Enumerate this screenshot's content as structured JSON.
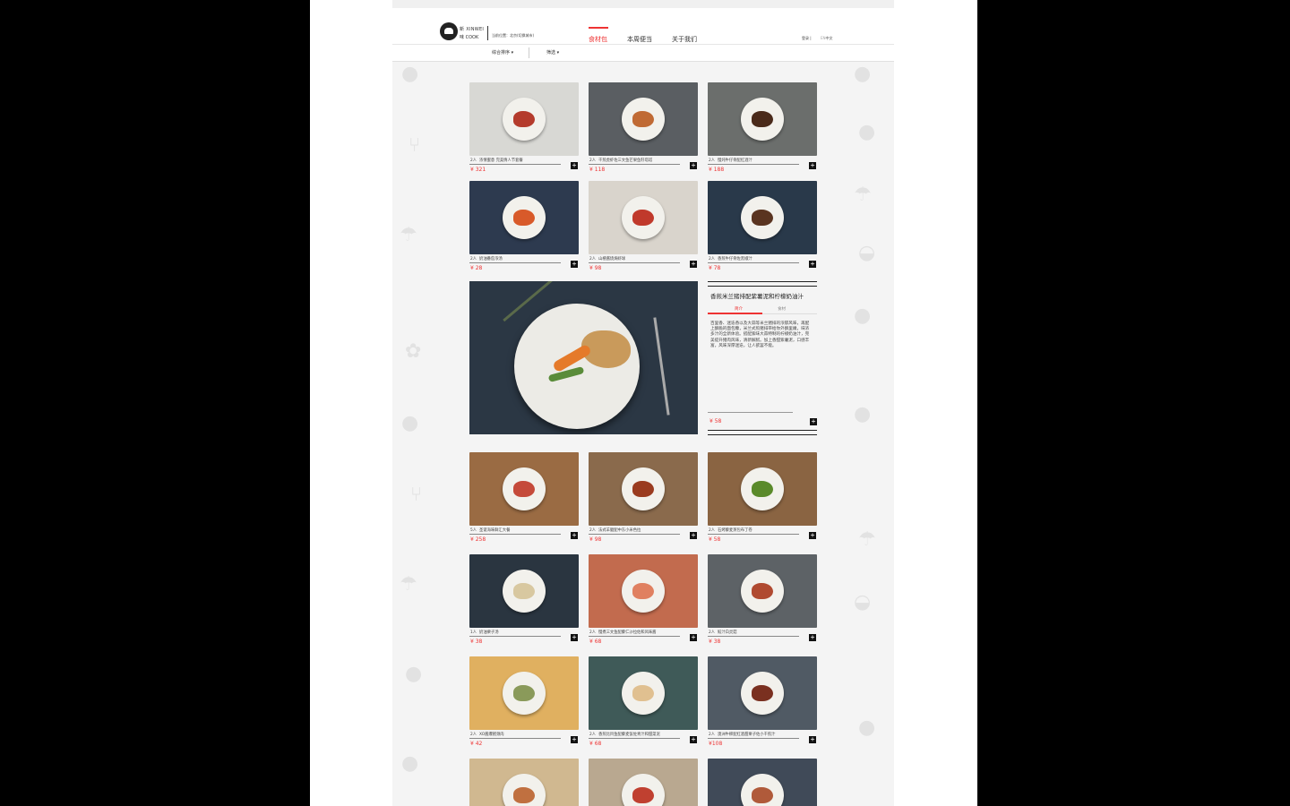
{
  "header": {
    "brand_line1": "新 XINWEI",
    "brand_line2": "味 COOK",
    "location": "当前位置：北京(切换城市)",
    "nav": [
      "食材包",
      "本周便当",
      "关于我们"
    ],
    "login": "登录 |",
    "lang_en": "EN",
    "lang_cn": "中文"
  },
  "filters": {
    "sort": "综合排序 ▾",
    "filter": "筛选 ▾"
  },
  "colors": {
    "accent": "#e33333",
    "text": "#333333",
    "page_bg": "#f4f4f4"
  },
  "products": [
    {
      "portion": "2人",
      "name": "浓情蜜意 完美情人节套餐",
      "price": "¥ 321",
      "bg": "#d8d8d4",
      "food": "#b43b2c"
    },
    {
      "portion": "2人",
      "name": "干煎虎虾佐三文鱼芒果鱼籽塔塔",
      "price": "¥ 118",
      "bg": "#5a5e62",
      "food": "#c06a34"
    },
    {
      "portion": "2人",
      "name": "慢炖牛仔骨配红酒汁",
      "price": "¥ 188",
      "bg": "#6b6e6c",
      "food": "#4a2a1a"
    },
    {
      "portion": "2人",
      "name": "奶油番茄浓汤",
      "price": "¥ 28",
      "bg": "#2d3a4f",
      "food": "#d85a2a"
    },
    {
      "portion": "2人",
      "name": "山楂酱烧焗虾球",
      "price": "¥ 98",
      "bg": "#d9d4cc",
      "food": "#c0392b"
    },
    {
      "portion": "2人",
      "name": "香煎牛仔骨佐黑椒汁",
      "price": "¥ 78",
      "bg": "#29394a",
      "food": "#5a3420"
    },
    {
      "portion": "5人",
      "name": "圣诞海味鲜汇大餐",
      "price": "¥ 258",
      "bg": "#9a6b43",
      "food": "#c54a3a"
    },
    {
      "portion": "2人",
      "name": "法式羊腿配中东小米色拉",
      "price": "¥ 98",
      "bg": "#8a6a4c",
      "food": "#9a3b1f"
    },
    {
      "portion": "2人",
      "name": "石烤藜麦蒸包布丁卷",
      "price": "¥ 58",
      "bg": "#8a6442",
      "food": "#5a8a2a"
    },
    {
      "portion": "1人",
      "name": "奶油栗子汤",
      "price": "¥ 38",
      "bg": "#2a3540",
      "food": "#d8c8a0"
    },
    {
      "portion": "2人",
      "name": "慢煮三文鱼配藜仁沙拉佐和风味酱",
      "price": "¥ 68",
      "bg": "#c26b4e",
      "food": "#e08060"
    },
    {
      "portion": "2人",
      "name": "鲑汁白灵菇",
      "price": "¥ 38",
      "bg": "#5d6266",
      "food": "#b04a30"
    },
    {
      "portion": "2人",
      "name": "XO酱爆猪颈肉",
      "price": "¥ 42",
      "bg": "#e0b060",
      "food": "#8a9a5a"
    },
    {
      "portion": "2人",
      "name": "香煎比目鱼配藜麦饭佐青汁和甜菜泥",
      "price": "¥ 68",
      "bg": "#3f5a58",
      "food": "#e0c090"
    },
    {
      "portion": "2人",
      "name": "澳洲牛柳配红酒甜栗子佐小干煎汁",
      "price": "¥108",
      "bg": "#505a64",
      "food": "#7a3020"
    },
    {
      "portion": "",
      "name": "",
      "price": "",
      "bg": "#d0b890",
      "food": "#c07040"
    },
    {
      "portion": "",
      "name": "",
      "price": "",
      "bg": "#b9a890",
      "food": "#c04030"
    },
    {
      "portion": "",
      "name": "",
      "price": "",
      "bg": "#404a58",
      "food": "#b05a3a"
    }
  ],
  "featured": {
    "title": "香煎米兰猪排配紫薯泥和柠檬奶油汁",
    "tab_intro": "简介",
    "tab_ingredients": "食材",
    "description": "百里香、迷迭香以及大蒜等米兰猪排的浓郁风味，再配上酥脆的面包糠，米兰式煎猪排带给你外酥里嫩，味浓多汁的全新体验。搭配紫味大蒜特制的柠檬奶油汁，完美提升猪肉风味，清新解腻。加上香甜紫薯泥，口感丰富，风味深厚迷迭，让人欲罢不能。",
    "price": "¥ 58"
  },
  "add_symbol": "+"
}
